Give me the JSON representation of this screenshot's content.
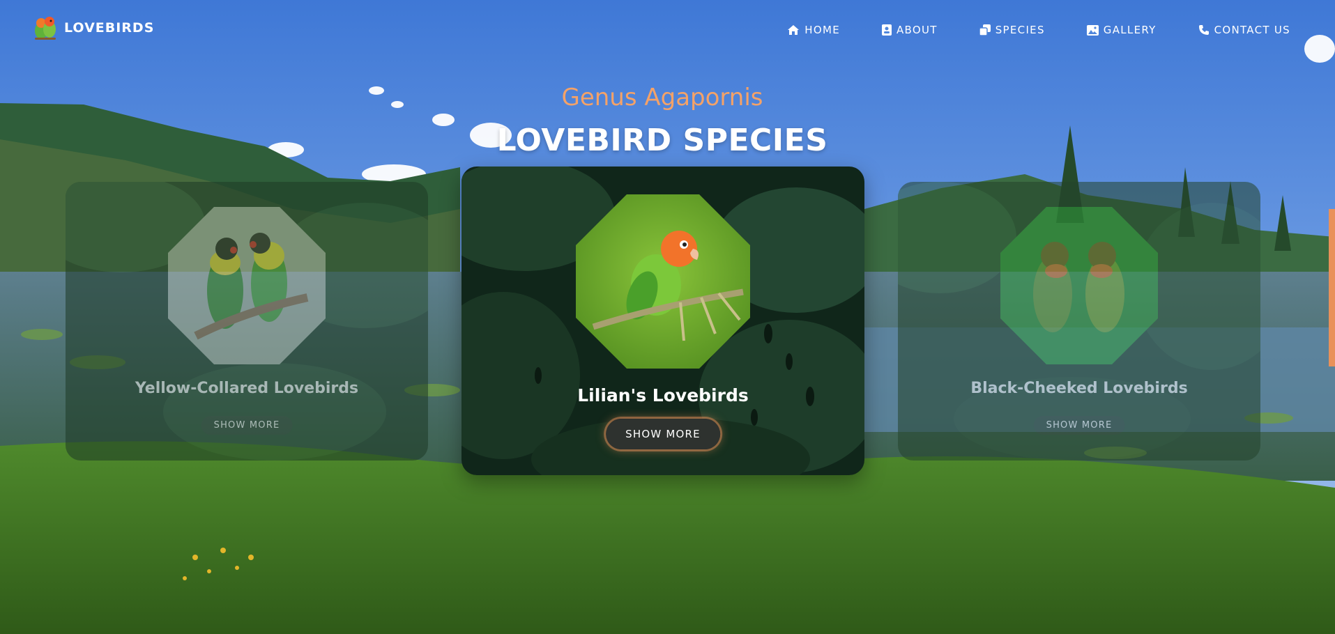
{
  "brand": {
    "name": "LOVEBIRDS"
  },
  "nav": {
    "items": [
      {
        "label": "HOME",
        "icon": "home-icon"
      },
      {
        "label": "ABOUT",
        "icon": "about-card-icon"
      },
      {
        "label": "SPECIES",
        "icon": "species-clone-icon"
      },
      {
        "label": "GALLERY",
        "icon": "gallery-image-icon"
      },
      {
        "label": "CONTACT US",
        "icon": "phone-icon"
      }
    ]
  },
  "section": {
    "subtitle": "Genus Agapornis",
    "title": "LOVEBIRD SPECIES"
  },
  "cards": [
    {
      "name": "Yellow-Collared Lovebirds",
      "button": "SHOW MORE",
      "state": "side"
    },
    {
      "name": "Lilian's Lovebirds",
      "button": "SHOW MORE",
      "state": "active"
    },
    {
      "name": "Black-Cheeked Lovebirds",
      "button": "SHOW MORE",
      "state": "side"
    }
  ],
  "colors": {
    "accent": "#f4a268",
    "button_glow": "#e9915a",
    "sky": "#4f86dc",
    "foliage_dark": "#1d3a26"
  }
}
